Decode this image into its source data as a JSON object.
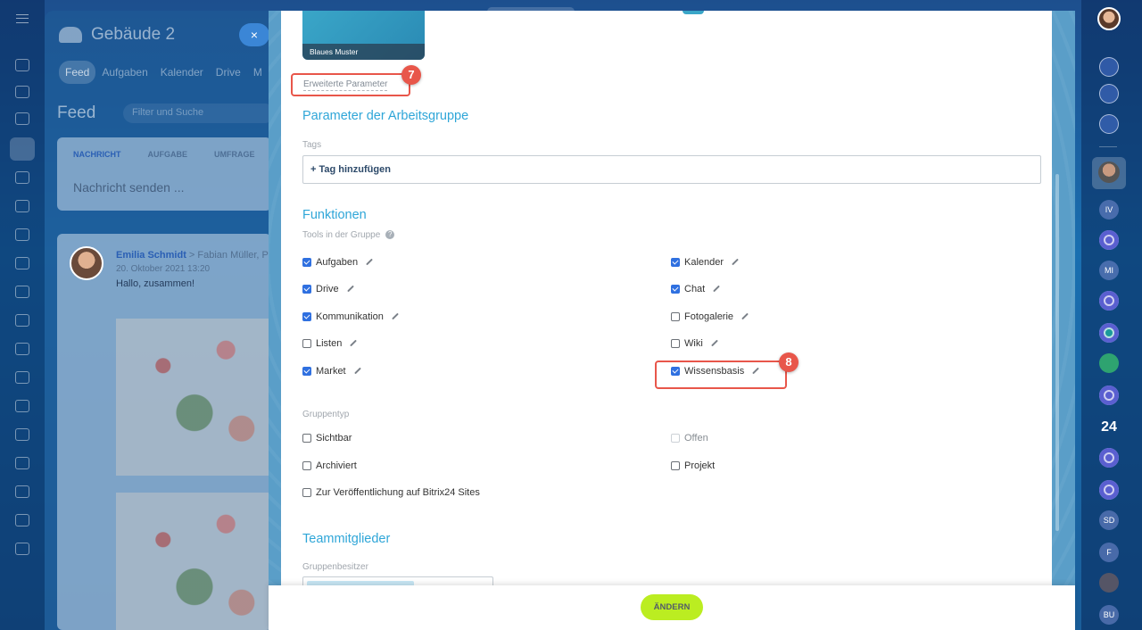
{
  "background": {
    "workgroup_title": "Gebäude 2",
    "close_symbol": "×",
    "tabs": [
      "Feed",
      "Aufgaben",
      "Kalender",
      "Drive",
      "M"
    ],
    "feed_title": "Feed",
    "search_placeholder": "Filter und Suche",
    "composer_tabs": [
      "NACHRICHT",
      "AUFGABE",
      "UMFRAGE"
    ],
    "composer_placeholder": "Nachricht senden ...",
    "post": {
      "author": "Emilia Schmidt",
      "recipients": "> Fabian Müller, P",
      "date": "20. Oktober 2021 13:20",
      "message": "Hallo, zusammen!"
    }
  },
  "right_rail": {
    "badges": [
      "IV",
      "MI",
      "SD",
      "F",
      "BU"
    ],
    "label_24": "24"
  },
  "form": {
    "thumbnail_label": "Blaues Muster",
    "advanced_link": "Erweiterte Parameter",
    "parameters_title": "Parameter der Arbeitsgruppe",
    "tags_label": "Tags",
    "tags_add": "+ Tag hinzufügen",
    "functions_title": "Funktionen",
    "tools_label": "Tools in der Gruppe",
    "help_symbol": "?",
    "tools": [
      {
        "label": "Aufgaben",
        "checked": true
      },
      {
        "label": "Kalender",
        "checked": true
      },
      {
        "label": "Drive",
        "checked": true
      },
      {
        "label": "Chat",
        "checked": true
      },
      {
        "label": "Kommunikation",
        "checked": true
      },
      {
        "label": "Fotogalerie",
        "checked": false
      },
      {
        "label": "Listen",
        "checked": false
      },
      {
        "label": "Wiki",
        "checked": false
      },
      {
        "label": "Market",
        "checked": true
      },
      {
        "label": "Wissensbasis",
        "checked": true
      }
    ],
    "group_type_label": "Gruppentyp",
    "group_types": [
      {
        "label": "Sichtbar",
        "checked": false
      },
      {
        "label": "Offen",
        "checked": false,
        "disabled": true
      },
      {
        "label": "Archiviert",
        "checked": false
      },
      {
        "label": "Projekt",
        "checked": false
      },
      {
        "label": "Zur Veröffentlichung auf Bitrix24 Sites",
        "checked": false
      }
    ],
    "team_title": "Teammitglieder",
    "owner_label": "Gruppenbesitzer"
  },
  "annotations": {
    "step_7": "7",
    "step_8": "8",
    "highlight_color": "#e8564a"
  },
  "footer": {
    "save_label": "ÄNDERN",
    "save_color": "#bbed21"
  },
  "colors": {
    "accent": "#2fa6d8",
    "checkbox": "#2f70e0"
  }
}
